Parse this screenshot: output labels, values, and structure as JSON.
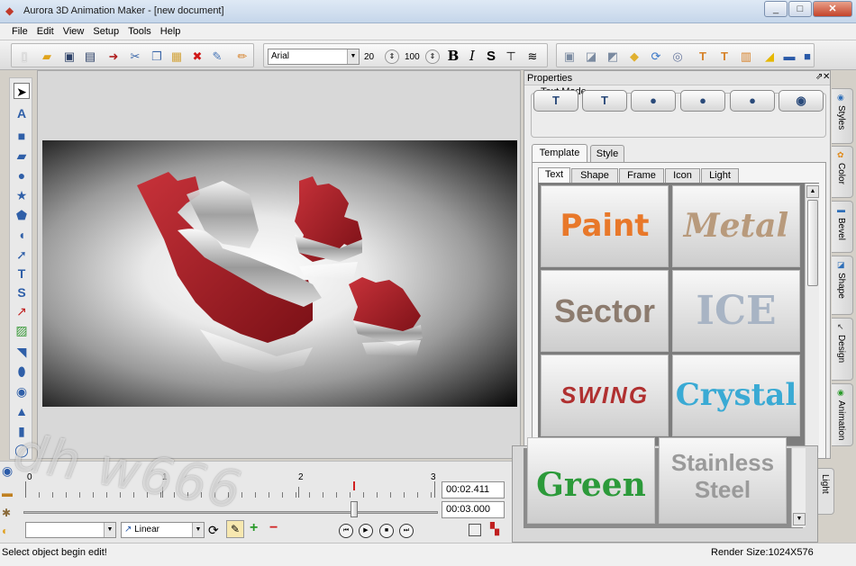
{
  "window": {
    "title": "Aurora 3D Animation Maker - [new document]",
    "minimize": "_",
    "maximize": "□",
    "close": "✕"
  },
  "menu": [
    "File",
    "Edit",
    "View",
    "Setup",
    "Tools",
    "Help"
  ],
  "toolbar": {
    "font": "Arial",
    "font_size": "20",
    "depth": "100",
    "bold": "B",
    "italic": "I",
    "strike": "S",
    "font_dropdown_arrow": "▼"
  },
  "left_tools": [
    "select-arrow-icon",
    "text-icon",
    "rectangle-icon",
    "rounded-rect-icon",
    "circle-icon",
    "star-icon",
    "pentagon-icon",
    "shield-icon",
    "arrow-icon",
    "text-3d-icon",
    "s-shape-icon",
    "line-icon",
    "image-icon",
    "block-icon",
    "cylinder-icon",
    "sphere-icon",
    "cone-icon",
    "cube-icon",
    "ring-icon"
  ],
  "properties": {
    "title": "Properties",
    "pin": "⇗",
    "close": "✕",
    "text_mode_label": "Text Mode",
    "tabs": [
      "Template",
      "Style"
    ],
    "subtabs": [
      "Text",
      "Shape",
      "Frame",
      "Icon",
      "Light"
    ],
    "templates": [
      {
        "name": "Paint",
        "color": "#e8782a"
      },
      {
        "name": "Metal",
        "color": "#b89a7c"
      },
      {
        "name": "Sector",
        "color": "#8c7b6e"
      },
      {
        "name": "ICE",
        "color": "#a8b4c4"
      },
      {
        "name": "SWING",
        "color": "#b03030"
      },
      {
        "name": "Crystal",
        "color": "#3aaad4"
      }
    ]
  },
  "side_tabs": [
    "Styles",
    "Color",
    "Bevel",
    "Shape",
    "Design",
    "Animation"
  ],
  "overlay": {
    "templates": [
      {
        "name": "Green",
        "color": "#2c9a3a"
      },
      {
        "name": "Stainless Steel",
        "color": "#9a9a9a"
      }
    ],
    "light_tab": "Light"
  },
  "timeline": {
    "ruler_labels": [
      "0",
      "1",
      "2",
      "3"
    ],
    "current_time": "00:02.411",
    "total_time": "00:03.000",
    "interpolation": "Linear",
    "dropdown_arrow": "▼"
  },
  "playback": [
    "⏮",
    "▶",
    "■",
    "⏭"
  ],
  "status": {
    "left": "Select object begin edit!",
    "right": "Render Size:1024X576"
  },
  "watermark": "dh w666"
}
